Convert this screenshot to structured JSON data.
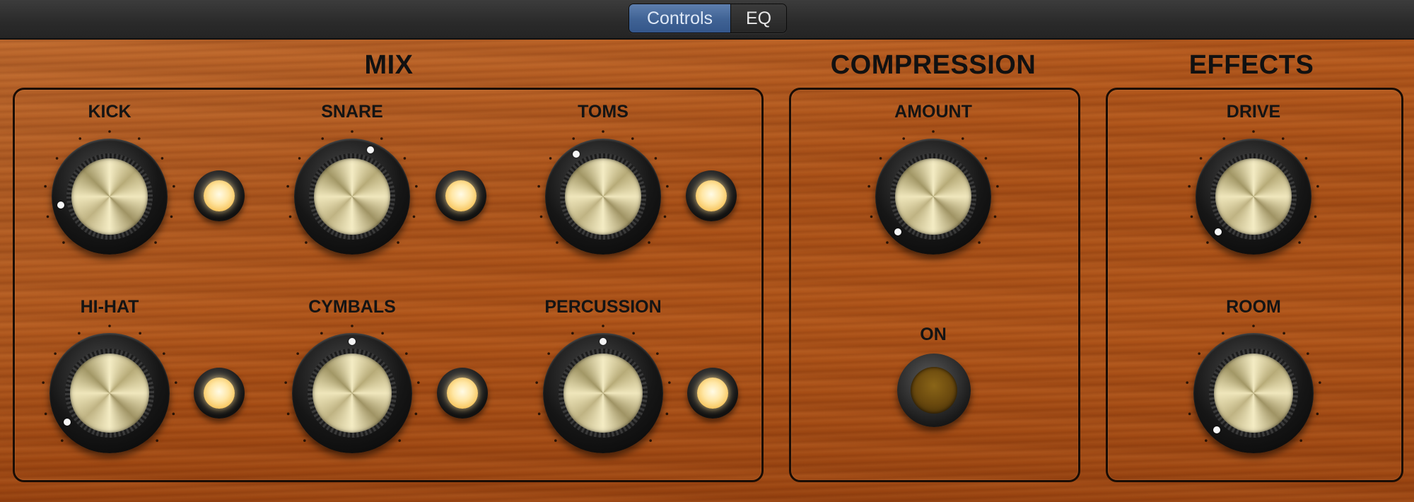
{
  "tabs": [
    {
      "label": "Controls",
      "selected": true
    },
    {
      "label": "EQ",
      "selected": false
    }
  ],
  "sections": {
    "mix": "MIX",
    "compression": "COMPRESSION",
    "effects": "EFFECTS"
  },
  "knobs": {
    "kick": {
      "label": "KICK",
      "value": 0.13
    },
    "snare": {
      "label": "SNARE",
      "value": 0.58
    },
    "toms": {
      "label": "TOMS",
      "value": 0.38
    },
    "hihat": {
      "label": "HI-HAT",
      "value": 0.04
    },
    "cymbals": {
      "label": "CYMBALS",
      "value": 0.5
    },
    "percussion": {
      "label": "PERCUSSION",
      "value": 0.5
    },
    "amount": {
      "label": "AMOUNT",
      "value": 0.0
    },
    "drive": {
      "label": "DRIVE",
      "value": 0.0
    },
    "room": {
      "label": "ROOM",
      "value": 0.0
    }
  },
  "mix_lamps": {
    "kick": true,
    "snare": true,
    "toms": true,
    "hihat": true,
    "cymbals": true,
    "percussion": true
  },
  "compression_on": {
    "label": "ON",
    "value": false
  },
  "colors": {
    "wood": "#a84f16",
    "segment_selected": "#3f6294",
    "lamp_lit": "#ffe7a6",
    "lamp_unlit": "#6b4a0e"
  }
}
